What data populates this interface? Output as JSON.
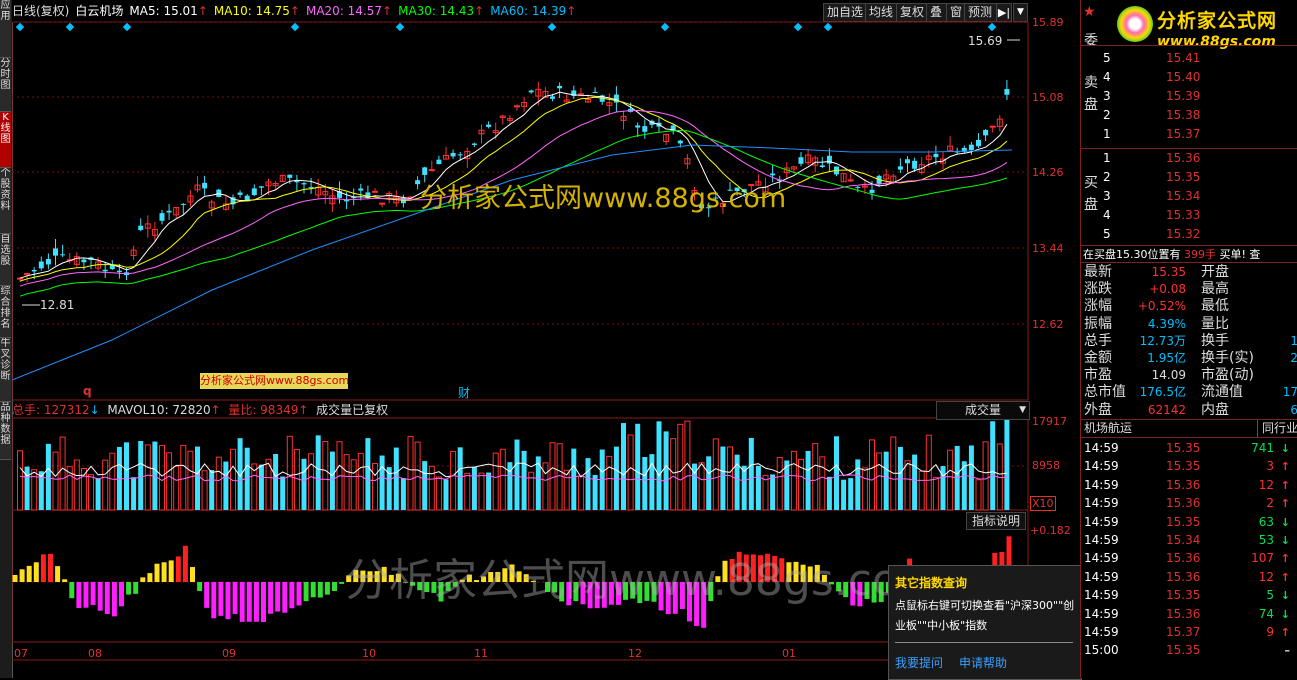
{
  "left_tabs": [
    "应用",
    "分时图",
    "K线图",
    "个股资料",
    "自选股",
    "综合排名",
    "牛叉诊断",
    "品种数据"
  ],
  "header": {
    "period": "日线(复权)",
    "stock_name": "白云机场",
    "ma": [
      {
        "label": "MA5: 15.01",
        "color": "#ffffff"
      },
      {
        "label": "MA10: 14.75",
        "color": "#ffff00"
      },
      {
        "label": "MA20: 14.57",
        "color": "#ff66ff"
      },
      {
        "label": "MA30: 14.43",
        "color": "#00ff00"
      },
      {
        "label": "MA60: 14.39",
        "color": "#00bfff"
      }
    ],
    "buttons": [
      "加自选",
      "均线",
      "复权",
      "叠",
      "窗",
      "预测"
    ]
  },
  "price_axis": [
    "15.89",
    "15.08",
    "14.26",
    "13.44",
    "12.62"
  ],
  "annotations": {
    "high": "15.69",
    "low": "12.81",
    "event_q": "q",
    "event_cai": "财"
  },
  "watermarks": {
    "main": "分析家公式网www.88gs.com",
    "small": "分析家公式网www.88gs.com",
    "bottom": "分析家公式网www.88gs.com",
    "logo_title": "分析家公式网",
    "logo_url": "www.88gs.com"
  },
  "volume": {
    "total": "总手: 127312",
    "mavol": "MAVOL10: 72820",
    "ratio": "量比: 98349",
    "note": "成交量已复权",
    "dropdown": "成交量",
    "axis": [
      "17917",
      "8958"
    ],
    "unit": "X10"
  },
  "indicator": {
    "button": "指标说明",
    "axis_top": "+0.182"
  },
  "date_axis": [
    "07",
    "08",
    "09",
    "10",
    "11",
    "12",
    "01"
  ],
  "popup": {
    "title": "其它指数查询",
    "text": "点鼠标右键可切换查看\"沪深300\"\"创业板\"\"中小板\"指数",
    "link1": "我要提问",
    "link2": "申请帮助"
  },
  "orderbook": {
    "wei_label": "委",
    "sell_label": "卖盘",
    "buy_label": "买盘",
    "sell": [
      {
        "idx": "5",
        "price": "15.41"
      },
      {
        "idx": "4",
        "price": "15.40"
      },
      {
        "idx": "3",
        "price": "15.39"
      },
      {
        "idx": "2",
        "price": "15.38"
      },
      {
        "idx": "1",
        "price": "15.37"
      }
    ],
    "buy": [
      {
        "idx": "1",
        "price": "15.36"
      },
      {
        "idx": "2",
        "price": "15.35"
      },
      {
        "idx": "3",
        "price": "15.34"
      },
      {
        "idx": "4",
        "price": "15.33"
      },
      {
        "idx": "5",
        "price": "15.32"
      }
    ],
    "status": "在买盘15.30位置有",
    "status_count": "399手",
    "status_tail": "买单! 查"
  },
  "quote": [
    {
      "l": "最新",
      "v": "15.35",
      "vc": "#ff3030",
      "l2": "开盘"
    },
    {
      "l": "涨跌",
      "v": "+0.08",
      "vc": "#ff3030",
      "l2": "最高"
    },
    {
      "l": "涨幅",
      "v": "+0.52%",
      "vc": "#ff3030",
      "l2": "最低"
    },
    {
      "l": "振幅",
      "v": "4.39%",
      "vc": "#00bfff",
      "l2": "量比"
    },
    {
      "l": "总手",
      "v": "12.73万",
      "vc": "#00bfff",
      "l2": "换手",
      "v2": "1"
    },
    {
      "l": "金额",
      "v": "1.95亿",
      "vc": "#00bfff",
      "l2": "换手(实)",
      "v2": "2"
    },
    {
      "l": "市盈",
      "v": "14.09",
      "vc": "#dddddd",
      "l2": "市盈(动)"
    },
    {
      "l": "总市值",
      "v": "176.5亿",
      "vc": "#00bfff",
      "l2": "流通值",
      "v2": "17"
    },
    {
      "l": "外盘",
      "v": "62142",
      "vc": "#ff3030",
      "l2": "内盘",
      "v2": "6"
    }
  ],
  "ticks_header": {
    "left": "机场航运",
    "right": "同行业"
  },
  "ticks": [
    {
      "t": "14:59",
      "p": "15.35",
      "v": "741",
      "d": "dn"
    },
    {
      "t": "14:59",
      "p": "15.35",
      "v": "3",
      "d": "up"
    },
    {
      "t": "14:59",
      "p": "15.36",
      "v": "12",
      "d": "up"
    },
    {
      "t": "14:59",
      "p": "15.36",
      "v": "2",
      "d": "up"
    },
    {
      "t": "14:59",
      "p": "15.35",
      "v": "63",
      "d": "dn"
    },
    {
      "t": "14:59",
      "p": "15.34",
      "v": "53",
      "d": "dn"
    },
    {
      "t": "14:59",
      "p": "15.36",
      "v": "107",
      "d": "up"
    },
    {
      "t": "14:59",
      "p": "15.36",
      "v": "12",
      "d": "up"
    },
    {
      "t": "14:59",
      "p": "15.35",
      "v": "5",
      "d": "dn"
    },
    {
      "t": "14:59",
      "p": "15.36",
      "v": "74",
      "d": "dn"
    },
    {
      "t": "14:59",
      "p": "15.37",
      "v": "9",
      "d": "up"
    },
    {
      "t": "15:00",
      "p": "15.35",
      "v": "",
      "d": ""
    }
  ]
}
